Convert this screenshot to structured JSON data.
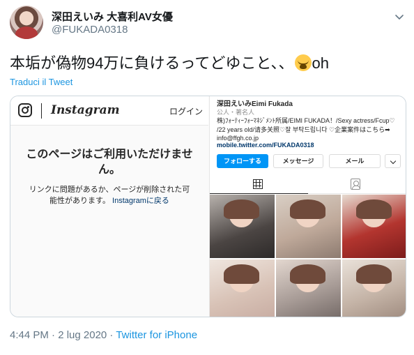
{
  "tweet": {
    "display_name": "深田えいみ 大喜利AV女優",
    "handle": "@FUKADA0318",
    "text_before_emoji": "本垢が偽物94万に負けるってどゆこと、、",
    "text_after_emoji": "oh",
    "emoji_icon": "loudly-crying-face-icon",
    "translate_label": "Traduci il Tweet",
    "timestamp": "4:44 PM · 2 lug 2020 · ",
    "source": "Twitter for iPhone"
  },
  "instagram_left": {
    "wordmark": "Instagram",
    "login_label": "ログイン",
    "unavailable_title": "このページはご利用いただけません。",
    "unavailable_body": "リンクに問題があるか、ページが削除された可能性があります。",
    "back_link": "Instagramに戻る"
  },
  "instagram_profile": {
    "name": "深田えいみEimi Fukada",
    "category": "公人・著名人",
    "bio": "株)ﾌｫｰﾃｨｰﾌｫｰﾏﾈｼﾞﾒﾝﾄ所属/EIMI FUKADA！/Sexy actress/Fcup♡ /22 years old/请多关照♡잘 부탁드립니다 ♡企業案件はこちら➡ info@ffgh.co.jp",
    "link": "mobile.twitter.com/FUKADA0318",
    "follow_label": "フォローする",
    "message_label": "メッセージ",
    "mail_label": "メール",
    "grid_tab_icon": "grid-icon",
    "tagged_tab_icon": "tagged-person-icon"
  },
  "colors": {
    "twitter_blue": "#1b95e0",
    "ig_follow_blue": "#0095f6",
    "secondary_text": "#657786"
  }
}
